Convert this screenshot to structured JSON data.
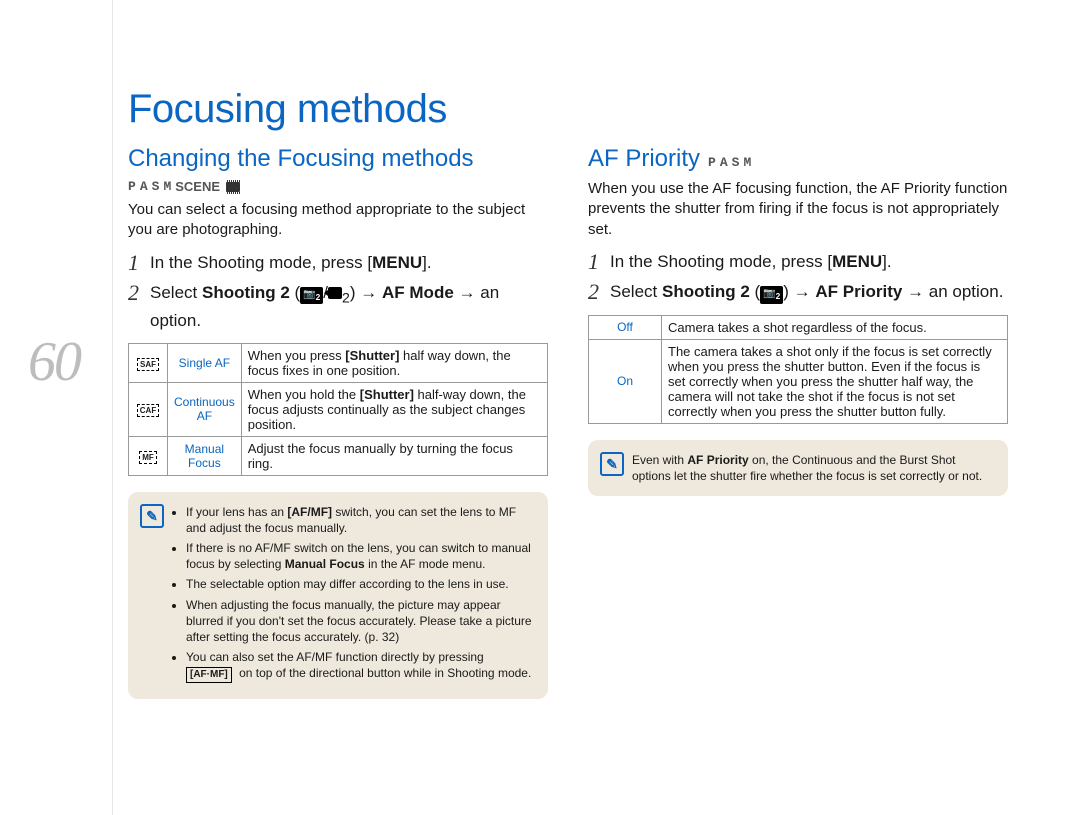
{
  "page_number": "60",
  "title": "Focusing methods",
  "left": {
    "heading": "Changing the Focusing methods",
    "modes": {
      "p": "P",
      "a": "A",
      "s": "S",
      "m": "M",
      "scene": "SCENE"
    },
    "intro": "You can select a focusing method appropriate to the subject you are photographing.",
    "step1_a": "In the Shooting mode, press ",
    "step1_b": "MENU",
    "step1_c": ".",
    "step2_a": "Select ",
    "step2_b": "Shooting 2",
    "step2_c": " (",
    "step2_d": ")  → ",
    "step2_e": "AF Mode",
    "step2_f": " → an option.",
    "table": [
      {
        "icon": "SAF",
        "label": "Single AF",
        "desc_a": "When you press ",
        "desc_b": "[Shutter]",
        "desc_c": " half way down, the focus fixes in one position."
      },
      {
        "icon": "CAF",
        "label": "Continuous AF",
        "desc_a": "When you hold the ",
        "desc_b": "[Shutter]",
        "desc_c": " half-way down, the focus adjusts continually as the subject changes position."
      },
      {
        "icon": "MF",
        "label": "Manual Focus",
        "desc": "Adjust the focus manually by turning the focus ring."
      }
    ],
    "notes": [
      {
        "a": "If your lens has an ",
        "b": "[AF/MF]",
        "c": " switch, you can set the lens to MF and adjust the focus manually."
      },
      {
        "a": "If there is no AF/MF switch on the lens, you can switch to manual focus by selecting ",
        "b": "Manual Focus",
        "c": " in the AF mode menu."
      },
      {
        "a": "The selectable option may differ according to the lens in use."
      },
      {
        "a": "When adjusting the focus manually, the picture may appear blurred if you don't set the focus accurately. Please take a picture after setting the focus accurately. (p. 32)"
      },
      {
        "a": "You can also set the AF/MF function directly by pressing ",
        "b": "[AF·MF]",
        "c": " on top of the directional button while in Shooting mode."
      }
    ]
  },
  "right": {
    "heading": "AF Priority",
    "modes": {
      "p": "P",
      "a": "A",
      "s": "S",
      "m": "M"
    },
    "intro": "When you use the AF focusing function, the AF Priority function prevents the shutter from firing if the focus is not appropriately set.",
    "step1_a": "In the Shooting mode, press ",
    "step1_b": "MENU",
    "step1_c": ".",
    "step2_a": "Select ",
    "step2_b": "Shooting 2",
    "step2_c": " (",
    "step2_d": ") → ",
    "step2_e": "AF Priority",
    "step2_f": " → an option.",
    "table": [
      {
        "label": "Off",
        "desc": "Camera takes a shot regardless of the focus."
      },
      {
        "label": "On",
        "desc": "The camera takes a shot only if the focus is set correctly when you press the shutter button. Even if the focus is set correctly when you press the shutter half way, the camera will not take the shot if the focus is not set correctly when you press the shutter button fully."
      }
    ],
    "note_a": "Even with ",
    "note_b": "AF Priority",
    "note_c": " on, the Continuous and the Burst Shot options let the shutter fire whether the focus is set correctly or not."
  }
}
